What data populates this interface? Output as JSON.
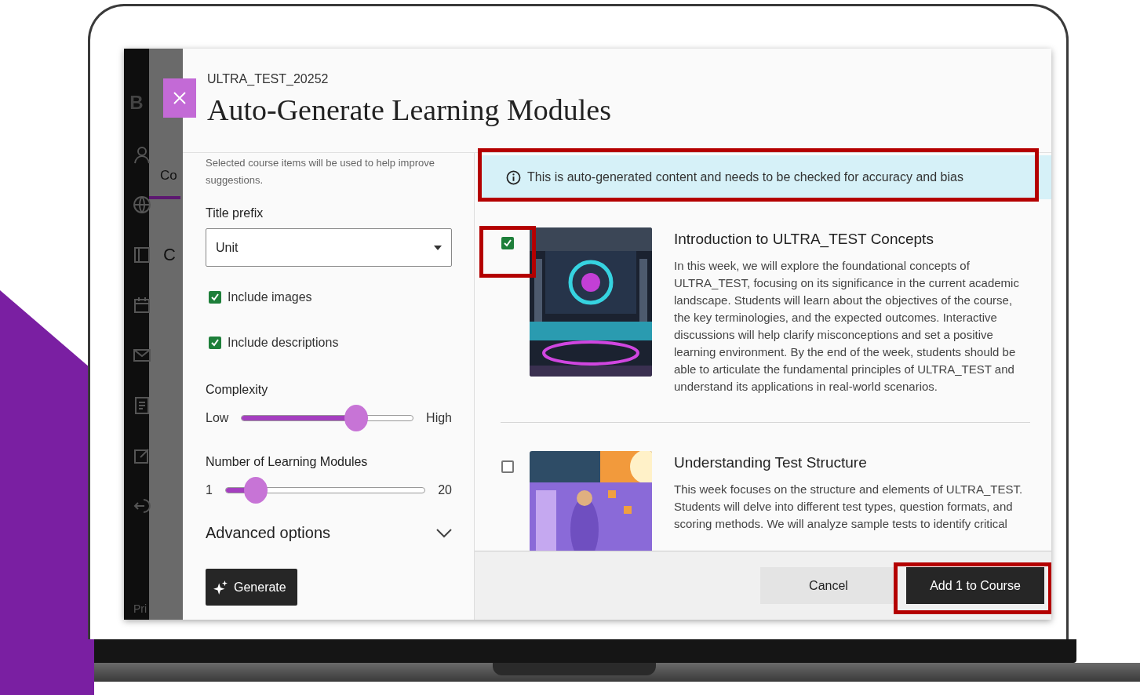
{
  "background": {
    "logo_fragment": "B",
    "tab_fragment": "Co",
    "heading_fragment": "C",
    "footer_fragment": "Pri"
  },
  "course_code": "ULTRA_TEST_20252",
  "title": "Auto-Generate Learning Modules",
  "intro": "Selected course items will be used to help improve suggestions.",
  "title_prefix": {
    "label": "Title prefix",
    "value": "Unit"
  },
  "options": [
    {
      "label": "Include images",
      "checked": true
    },
    {
      "label": "Include descriptions",
      "checked": true
    }
  ],
  "complexity": {
    "label": "Complexity",
    "min_label": "Low",
    "max_label": "High",
    "level": 0.67
  },
  "module_count": {
    "label": "Number of Learning Modules",
    "min_label": "1",
    "max_label": "20",
    "level": 0.15
  },
  "advanced": {
    "label": "Advanced options",
    "expanded": false
  },
  "generate_button": "Generate",
  "notice": {
    "text": "This is auto-generated content and needs to be checked for accuracy and bias",
    "highlighted": true
  },
  "modules": [
    {
      "title": "Introduction to ULTRA_TEST Concepts",
      "description": "In this week, we will explore the foundational concepts of ULTRA_TEST, focusing on its significance in the current academic landscape. Students will learn about the objectives of the course, the key terminologies, and the expected outcomes. Interactive discussions will help clarify misconceptions and set a positive learning environment. By the end of the week, students should be able to articulate the fundamental principles of ULTRA_TEST and understand its applications in real-world scenarios.",
      "selected": true,
      "highlighted": true
    },
    {
      "title": "Understanding Test Structure",
      "description": "This week focuses on the structure and elements of ULTRA_TEST. Students will delve into different test types, question formats, and scoring methods. We will analyze sample tests to identify critical",
      "selected": false,
      "highlighted": false
    }
  ],
  "footer": {
    "cancel": "Cancel",
    "add": "Add 1 to Course",
    "add_highlighted": true
  }
}
